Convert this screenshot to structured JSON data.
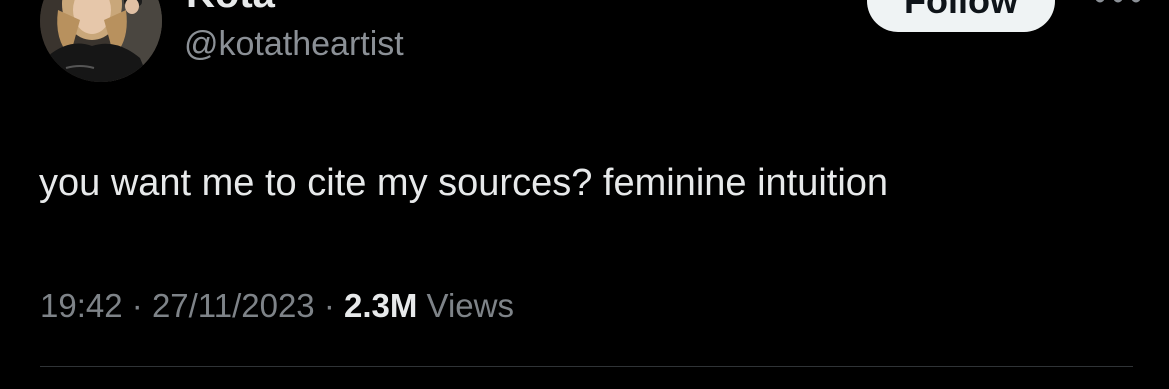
{
  "tweet": {
    "author": {
      "display_name": "Kota",
      "handle": "@kotatheartist",
      "avatar_icon": "profile-photo"
    },
    "follow_label": "Follow",
    "more_icon": "more-horizontal-icon",
    "text": "you want me to cite my sources? feminine intuition",
    "time": "19:42",
    "date": "27/11/2023",
    "separator": "·",
    "views_count": "2.3M",
    "views_label": "Views"
  },
  "colors": {
    "background": "#000000",
    "primary_text": "#e7e9ea",
    "secondary_text": "#7e8388",
    "follow_button_bg": "#eff3f4",
    "follow_button_text": "#0f1419"
  }
}
